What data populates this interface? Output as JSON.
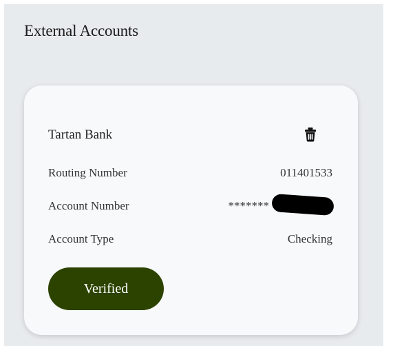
{
  "panel": {
    "title": "External Accounts"
  },
  "account": {
    "bank_name": "Tartan Bank",
    "delete_icon": "trash-icon",
    "routing_label": "Routing Number",
    "routing_value": "011401533",
    "account_label": "Account Number",
    "account_value": "*******",
    "type_label": "Account Type",
    "type_value": "Checking",
    "status_label": "Verified"
  },
  "colors": {
    "panel_bg": "#e8ebee",
    "card_bg": "#f8f9fb",
    "verified_bg": "#2c4300"
  }
}
